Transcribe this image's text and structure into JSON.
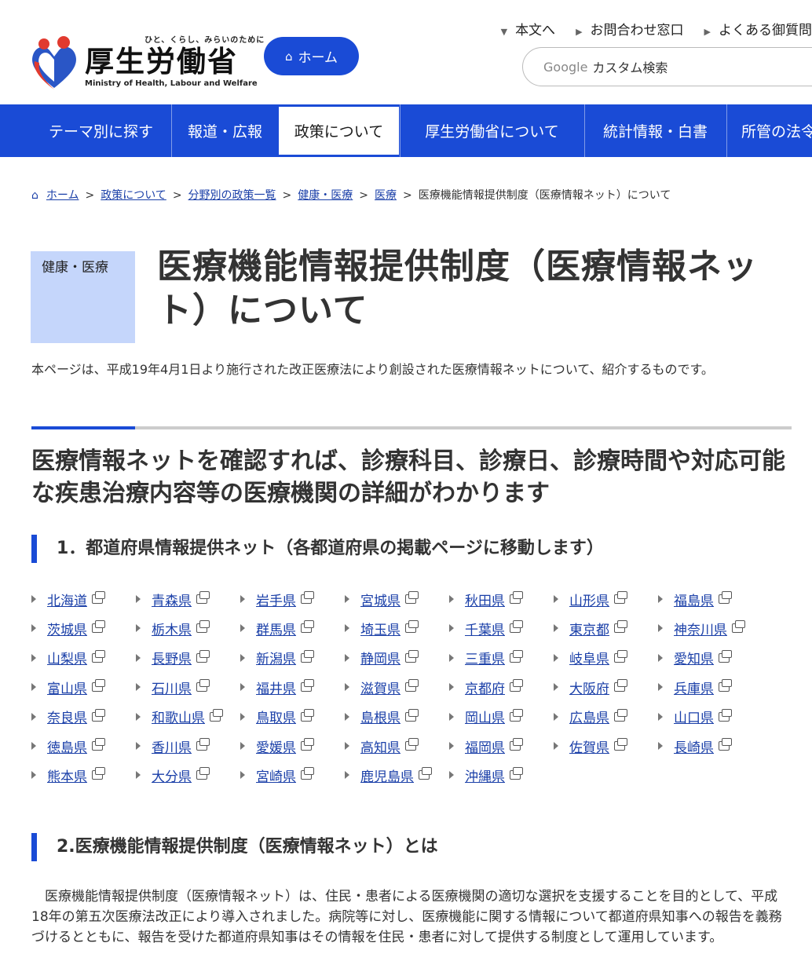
{
  "header": {
    "logo_tagline": "ひと、くらし、みらいのために",
    "logo_title": "厚生労働省",
    "logo_en": "Ministry of Health, Labour and Welfare",
    "home_button": "ホーム",
    "util_links": [
      "本文へ",
      "お問合わせ窓口",
      "よくある御質問"
    ],
    "search_brand": "Google",
    "search_placeholder": "カスタム検索"
  },
  "nav": {
    "items": [
      "テーマ別に探す",
      "報道・広報",
      "政策について",
      "厚生労働省について",
      "統計情報・白書",
      "所管の法令"
    ],
    "active": "政策について"
  },
  "breadcrumb": {
    "items": [
      "ホーム",
      "政策について",
      "分野別の政策一覧",
      "健康・医療",
      "医療"
    ],
    "current": "医療機能情報提供制度（医療情報ネット）について"
  },
  "page": {
    "category": "健康・医療",
    "title": "医療機能情報提供制度（医療情報ネット）について",
    "lead": "本ページは、平成19年4月1日より施行された改正医療法により創設された医療情報ネットについて、紹介するものです。",
    "h2": "医療情報ネットを確認すれば、診療科目、診療日、診療時間や対応可能な疾患治療内容等の医療機関の詳細がわかります",
    "section1_title": "1．都道府県情報提供ネット（各都道府県の掲載ページに移動します）",
    "section2_title": "2.医療機能情報提供制度（医療情報ネット）とは",
    "section2_body": "　医療機能情報提供制度（医療情報ネット）は、住民・患者による医療機関の適切な選択を支援することを目的として、平成18年の第五次医療法改正により導入されました。病院等に対し、医療機能に関する情報について都道府県知事への報告を義務づけるとともに、報告を受けた都道府県知事はその情報を住民・患者に対して提供する制度として運用しています。"
  },
  "prefectures": [
    [
      "北海道",
      "青森県",
      "岩手県",
      "宮城県",
      "秋田県",
      "山形県",
      "福島県"
    ],
    [
      "茨城県",
      "栃木県",
      "群馬県",
      "埼玉県",
      "千葉県",
      "東京都",
      "神奈川県"
    ],
    [
      "山梨県",
      "長野県",
      "新潟県",
      "静岡県",
      "三重県",
      "岐阜県",
      "愛知県"
    ],
    [
      "富山県",
      "石川県",
      "福井県",
      "滋賀県",
      "京都府",
      "大阪府",
      "兵庫県"
    ],
    [
      "奈良県",
      "和歌山県",
      "鳥取県",
      "島根県",
      "岡山県",
      "広島県",
      "山口県"
    ],
    [
      "徳島県",
      "香川県",
      "愛媛県",
      "高知県",
      "福岡県",
      "佐賀県",
      "長崎県"
    ],
    [
      "熊本県",
      "大分県",
      "宮崎県",
      "鹿児島県",
      "沖縄県"
    ]
  ],
  "colors": {
    "brand_blue": "#1a4bd6",
    "link": "#1a3fa8",
    "badge_bg": "#c5d6fb"
  },
  "icons": [
    "home-icon",
    "external-link-icon",
    "triangle-bullet-icon"
  ]
}
